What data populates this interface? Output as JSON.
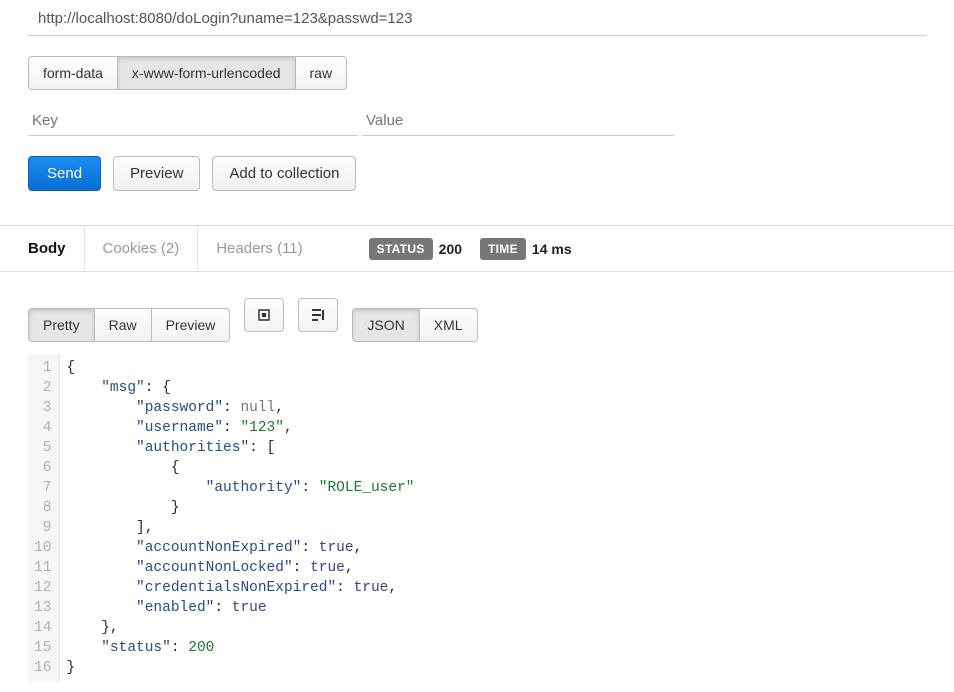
{
  "url": "http://localhost:8080/doLogin?uname=123&passwd=123",
  "body_types": {
    "items": [
      "form-data",
      "x-www-form-urlencoded",
      "raw"
    ],
    "active_index": 1
  },
  "kv": {
    "key_placeholder": "Key",
    "value_placeholder": "Value"
  },
  "actions": {
    "send": "Send",
    "preview": "Preview",
    "add_to_collection": "Add to collection"
  },
  "response_tabs": {
    "body": "Body",
    "cookies": "Cookies (2)",
    "headers": "Headers (11)"
  },
  "status": {
    "status_label": "STATUS",
    "status_code": "200",
    "time_label": "TIME",
    "time_value": "14 ms"
  },
  "resp_toolbar": {
    "view_modes": [
      "Pretty",
      "Raw",
      "Preview"
    ],
    "view_active_index": 0,
    "format_modes": [
      "JSON",
      "XML"
    ],
    "format_active_index": 0,
    "icon_fullscreen": "fullscreen-icon",
    "icon_wrap": "wrap-lines-icon"
  },
  "response_body": {
    "msg": {
      "password": null,
      "username": "123",
      "authorities": [
        {
          "authority": "ROLE_user"
        }
      ],
      "accountNonExpired": true,
      "accountNonLocked": true,
      "credentialsNonExpired": true,
      "enabled": true
    },
    "status": 200
  }
}
